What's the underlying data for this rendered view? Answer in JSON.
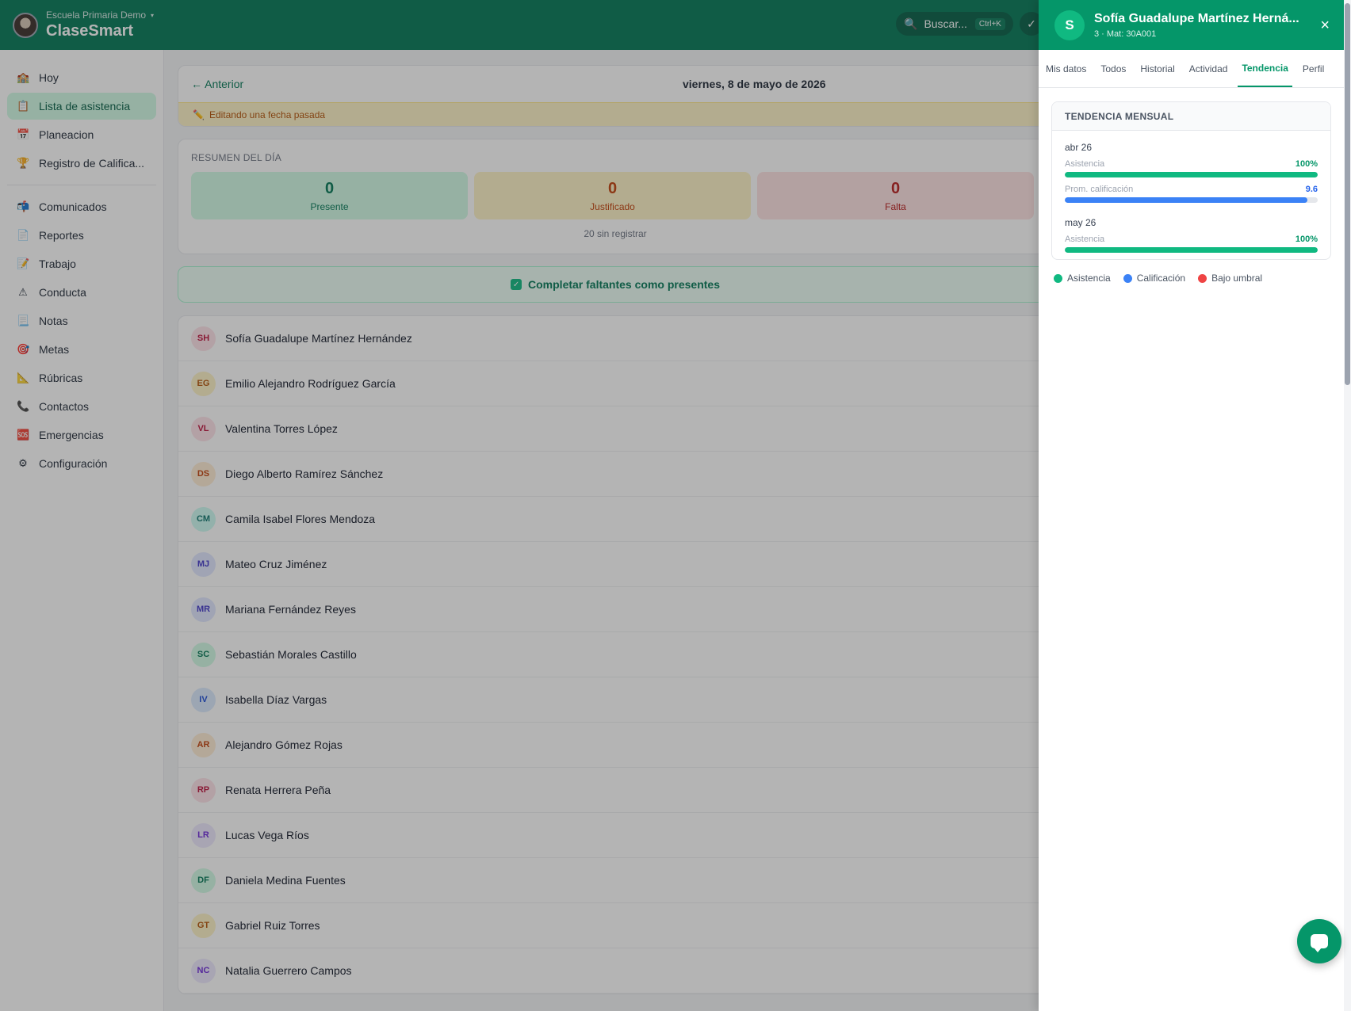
{
  "header": {
    "school": "Escuela Primaria Demo",
    "app_name": "ClaseSmart",
    "search_label": "Buscar...",
    "search_shortcut": "Ctrl+K",
    "check_label": "✓"
  },
  "sidebar": {
    "items": [
      {
        "label": "Hoy",
        "icon": "🏫"
      },
      {
        "label": "Lista de asistencia",
        "icon": "📋"
      },
      {
        "label": "Planeacion",
        "icon": "📅"
      },
      {
        "label": "Registro de Califica...",
        "icon": "🏆"
      },
      {
        "label": "Comunicados",
        "icon": "📬"
      },
      {
        "label": "Reportes",
        "icon": "📄"
      },
      {
        "label": "Trabajo",
        "icon": "📝"
      },
      {
        "label": "Conducta",
        "icon": "⚠"
      },
      {
        "label": "Notas",
        "icon": "📃"
      },
      {
        "label": "Metas",
        "icon": "🎯"
      },
      {
        "label": "Rúbricas",
        "icon": "📐"
      },
      {
        "label": "Contactos",
        "icon": "📞"
      },
      {
        "label": "Emergencias",
        "icon": "🆘"
      },
      {
        "label": "Configuración",
        "icon": "⚙"
      }
    ]
  },
  "attendance": {
    "prev_label": "← Anterior",
    "date": "viernes, 8 de mayo de 2026",
    "edit_notice": "Editando una fecha pasada",
    "summary_title": "RESUMEN DEL DÍA",
    "stats": {
      "present": {
        "value": "0",
        "label": "Presente"
      },
      "justified": {
        "value": "0",
        "label": "Justificado"
      },
      "absent": {
        "value": "0",
        "label": "Falta"
      }
    },
    "unregistered": "20 sin registrar",
    "complete_button": "Completar faltantes como presentes",
    "students": [
      {
        "initials": "SH",
        "name": "Sofía Guadalupe Martínez Hernández",
        "color": "rose"
      },
      {
        "initials": "EG",
        "name": "Emilio Alejandro Rodríguez García",
        "color": "amber"
      },
      {
        "initials": "VL",
        "name": "Valentina Torres López",
        "color": "rose"
      },
      {
        "initials": "DS",
        "name": "Diego Alberto Ramírez Sánchez",
        "color": "orange"
      },
      {
        "initials": "CM",
        "name": "Camila Isabel Flores Mendoza",
        "color": "teal"
      },
      {
        "initials": "MJ",
        "name": "Mateo Cruz Jiménez",
        "color": "indigo"
      },
      {
        "initials": "MR",
        "name": "Mariana Fernández Reyes",
        "color": "indigo"
      },
      {
        "initials": "SC",
        "name": "Sebastián Morales Castillo",
        "color": "green"
      },
      {
        "initials": "IV",
        "name": "Isabella Díaz Vargas",
        "color": "blue"
      },
      {
        "initials": "AR",
        "name": "Alejandro Gómez Rojas",
        "color": "orange"
      },
      {
        "initials": "RP",
        "name": "Renata Herrera Peña",
        "color": "rose"
      },
      {
        "initials": "LR",
        "name": "Lucas Vega Ríos",
        "color": "purple"
      },
      {
        "initials": "DF",
        "name": "Daniela Medina Fuentes",
        "color": "green"
      },
      {
        "initials": "GT",
        "name": "Gabriel Ruiz Torres",
        "color": "amber"
      },
      {
        "initials": "NC",
        "name": "Natalia Guerrero Campos",
        "color": "purple"
      }
    ]
  },
  "panel": {
    "avatar_letter": "S",
    "student_name": "Sofía Guadalupe Martínez Herná...",
    "subtitle": "3 · Mat: 30A001",
    "close_label": "×",
    "tabs": [
      "Mis datos",
      "Todos",
      "Historial",
      "Actividad",
      "Tendencia",
      "Perfil"
    ],
    "active_tab": "Tendencia",
    "trend_title": "TENDENCIA MENSUAL",
    "months": [
      {
        "label": "abr 26",
        "metrics": [
          {
            "label": "Asistencia",
            "display": "100%",
            "fraction": 1.0,
            "color": "#10b981",
            "text_color": "#059669"
          },
          {
            "label": "Prom. calificación",
            "display": "9.6",
            "fraction": 0.96,
            "color": "#3b82f6",
            "text_color": "#2563eb"
          }
        ]
      },
      {
        "label": "may 26",
        "metrics": [
          {
            "label": "Asistencia",
            "display": "100%",
            "fraction": 1.0,
            "color": "#10b981",
            "text_color": "#059669"
          }
        ]
      }
    ],
    "legend": [
      {
        "label": "Asistencia",
        "color": "#10b981"
      },
      {
        "label": "Calificación",
        "color": "#3b82f6"
      },
      {
        "label": "Bajo umbral",
        "color": "#ef4444"
      }
    ]
  }
}
